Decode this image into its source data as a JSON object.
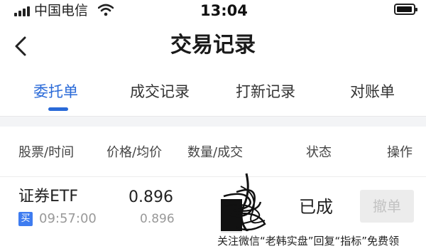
{
  "status_bar": {
    "carrier": "中国电信",
    "time": "13:04"
  },
  "header": {
    "back_icon": "chevron-left-icon",
    "title": "交易记录"
  },
  "tabs": [
    {
      "label": "委托单",
      "active": true
    },
    {
      "label": "成交记录",
      "active": false
    },
    {
      "label": "打新记录",
      "active": false
    },
    {
      "label": "对账单",
      "active": false
    }
  ],
  "table": {
    "columns": [
      "股票/时间",
      "价格/均价",
      "数量/成交",
      "状态",
      "操作"
    ],
    "rows": [
      {
        "name": "证券ETF",
        "side_badge": "买",
        "time": "09:57:00",
        "price": "0.896",
        "avg_price": "0.896",
        "status": "已成",
        "action": "撤单"
      }
    ]
  },
  "overlay": {
    "text": "关注微信“老韩实盘”回复“指标”免费领"
  },
  "colors": {
    "accent": "#2a6ad8",
    "badge": "#3e7cf0",
    "muted_text": "#999999",
    "button_bg": "#ececec",
    "button_text": "#c3c3c3"
  }
}
